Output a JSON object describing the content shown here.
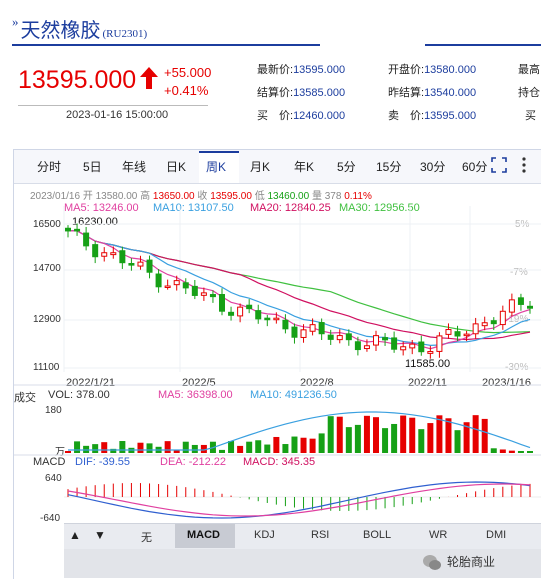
{
  "header": {
    "title": "天然橡胶",
    "code": "(RU2301)",
    "mark": "»"
  },
  "quote": {
    "price": "13595.000",
    "change": "+55.000",
    "change_pct": "+0.41%",
    "time": "2023-01-16 15:00:00"
  },
  "info": [
    {
      "label": "最新价:",
      "value": "13595.000"
    },
    {
      "label": "开盘价:",
      "value": "13580.000"
    },
    {
      "label": "最高",
      "value": ""
    },
    {
      "label": "结算价:",
      "value": "13585.000"
    },
    {
      "label": "昨结算:",
      "value": "13540.000"
    },
    {
      "label": "持仓",
      "value": ""
    },
    {
      "label": "买　价:",
      "value": "12460.000"
    },
    {
      "label": "卖　价:",
      "value": "13595.000"
    },
    {
      "label": "买",
      "value": ""
    }
  ],
  "period_tabs": [
    "分时",
    "5日",
    "年线",
    "日K",
    "周K",
    "月K",
    "年K",
    "5分",
    "15分",
    "30分",
    "60分"
  ],
  "active_tab": "周K",
  "ohlc": {
    "date": "2023/01/16",
    "open_l": "开",
    "open": "13580.00",
    "high_l": "高",
    "high": "13650.00",
    "close_l": "收",
    "close": "13595.00",
    "low_l": "低",
    "low": "13460.00",
    "vol_l": "量",
    "vol": "378",
    "chg": "0.11%"
  },
  "ma_labels": {
    "ma5": "MA5: 13246.00",
    "ma10": "MA10: 13107.50",
    "ma20": "MA20: 12840.25",
    "ma30": "MA30: 12956.50"
  },
  "price_axis": [
    "16500",
    "14700",
    "12900",
    "11100"
  ],
  "pct_axis": [
    "5%",
    "-7%",
    "-19%",
    "-30%"
  ],
  "x_axis": [
    "2022/1/21",
    "2022/5",
    "2022/8",
    "2022/11",
    "2023/1/16"
  ],
  "annotations": {
    "high": "16230.00",
    "low": "11585.00"
  },
  "volume": {
    "title": "成交",
    "vol": "VOL: 378.00",
    "ma5": "MA5: 36398.00",
    "ma10": "MA10: 491236.50",
    "axis_top": "180",
    "axis_unit": "万"
  },
  "macd": {
    "title": "MACD",
    "dif": "DIF: -39.55",
    "dea": "DEA: -212.22",
    "macd": "MACD: 345.35",
    "axis_top": "640",
    "axis_bottom": "-640"
  },
  "indicator_tabs": [
    "无",
    "MACD",
    "KDJ",
    "RSI",
    "BOLL",
    "WR",
    "DMI"
  ],
  "active_indicator": "MACD",
  "nav": {
    "up": "▲",
    "down": "▼"
  },
  "icons": {
    "fullscreen": "fullscreen-icon",
    "more": "more-icon"
  },
  "watermark": "轮胎商业",
  "colors": {
    "up": "#e60000",
    "down": "#16a016",
    "ma5": "#e040a0",
    "ma10": "#3aa0e0",
    "ma20": "#d01060",
    "ma30": "#40c040",
    "accent": "#1c3d9e"
  }
}
